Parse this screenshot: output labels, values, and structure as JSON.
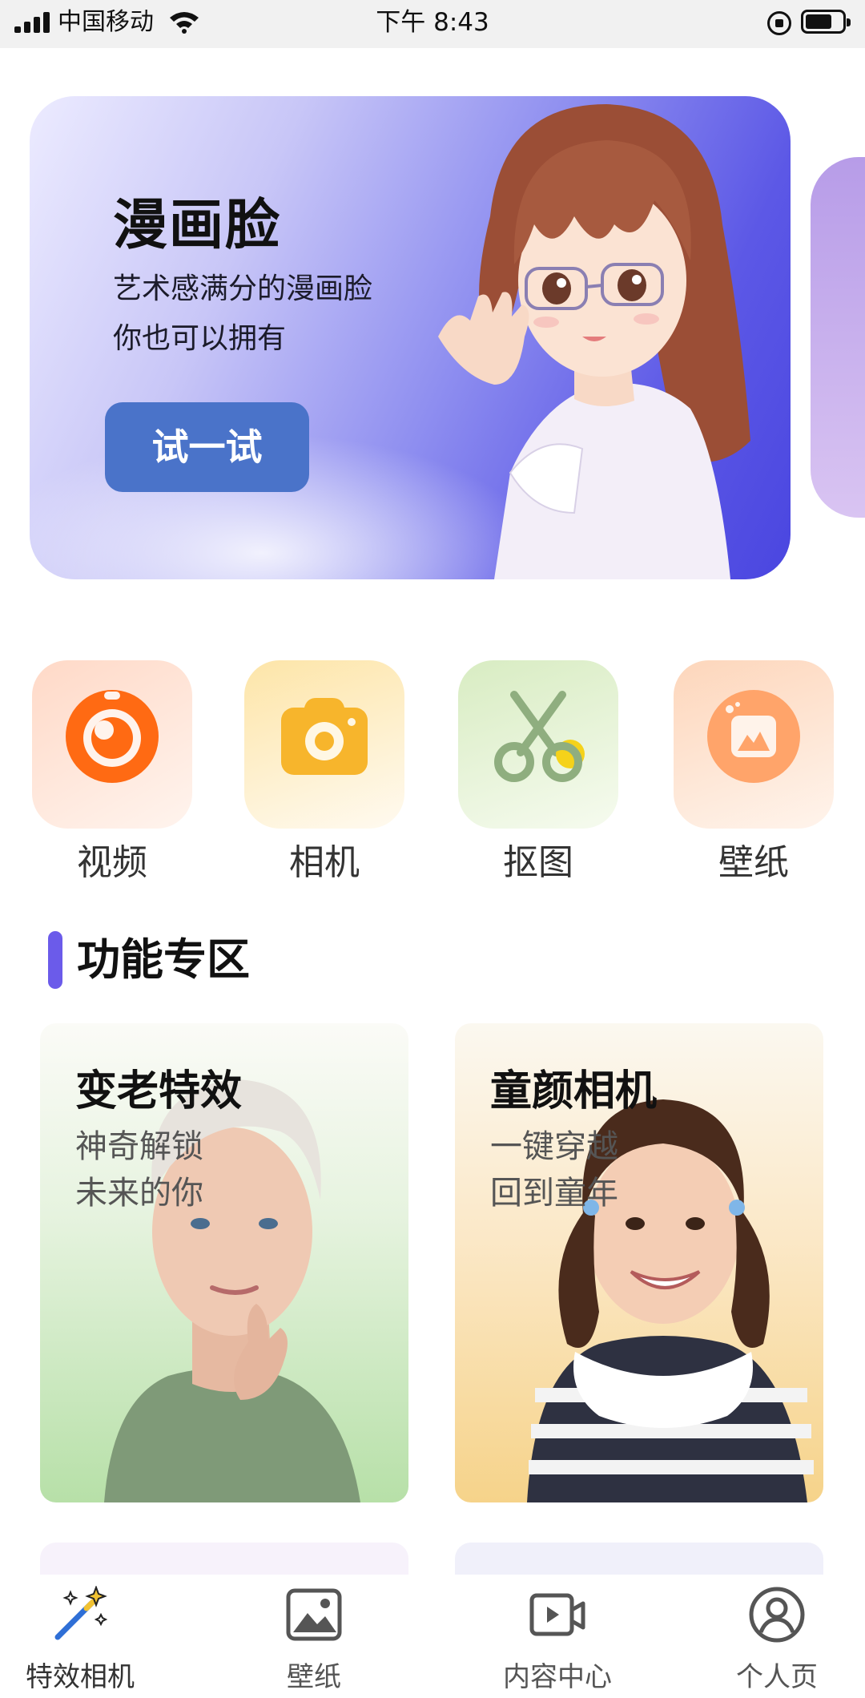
{
  "status_bar": {
    "carrier": "中国移动",
    "time": "下午 8:43"
  },
  "banner": {
    "title": "漫画脸",
    "subtitle_line1": "艺术感满分的漫画脸",
    "subtitle_line2": "你也可以拥有",
    "button_label": "试一试"
  },
  "quick_actions": [
    {
      "label": "视频",
      "icon": "video-icon"
    },
    {
      "label": "相机",
      "icon": "camera-icon"
    },
    {
      "label": "抠图",
      "icon": "scissors-icon"
    },
    {
      "label": "壁纸",
      "icon": "wallpaper-icon"
    }
  ],
  "section": {
    "title": "功能专区"
  },
  "feature_cards": [
    {
      "title": "变老特效",
      "sub_line1": "神奇解锁",
      "sub_line2": "未来的你"
    },
    {
      "title": "童颜相机",
      "sub_line1": "一键穿越",
      "sub_line2": "回到童年"
    }
  ],
  "tab_bar": {
    "tabs": [
      {
        "label": "特效相机",
        "icon": "magic-wand-icon",
        "active": true
      },
      {
        "label": "壁纸",
        "icon": "image-icon",
        "active": false
      },
      {
        "label": "内容中心",
        "icon": "video-play-icon",
        "active": false
      },
      {
        "label": "个人页",
        "icon": "user-icon",
        "active": false
      }
    ]
  },
  "colors": {
    "banner_button": "#4a73c9",
    "section_accent": "#6b5bea",
    "video_orange": "#ff6a13",
    "camera_yellow": "#f7b52c",
    "scissors_green": "#8fae7f",
    "wallpaper_orange": "#ffa46a"
  }
}
